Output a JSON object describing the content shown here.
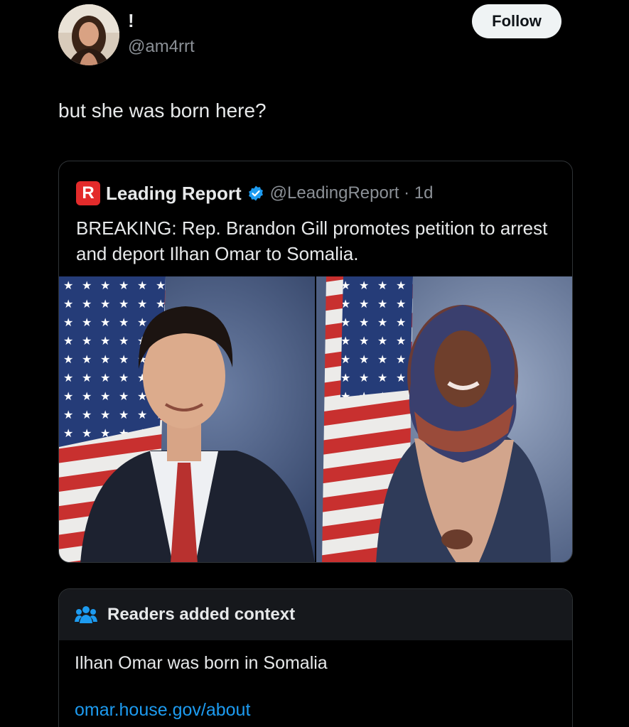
{
  "post": {
    "display_name": "!",
    "handle": "@am4rrt",
    "follow_label": "Follow",
    "text": "but she was born here?"
  },
  "quote": {
    "logo_letter": "R",
    "name": "Leading Report",
    "handle_time": "@LeadingReport · 1d",
    "text": "BREAKING: Rep. Brandon Gill promotes petition to arrest and deport Ilhan Omar to Somalia."
  },
  "note": {
    "title": "Readers added context",
    "text": "Ilhan Omar was born in Somalia",
    "link": "omar.house.gov/about"
  },
  "colors": {
    "background": "#000000",
    "accent": "#1d9bf0",
    "verified": "#1d9bf0",
    "brand_red": "#e32b2b"
  },
  "icons": [
    "avatar",
    "brand-logo",
    "verified-badge-icon",
    "community-notes-icon"
  ]
}
